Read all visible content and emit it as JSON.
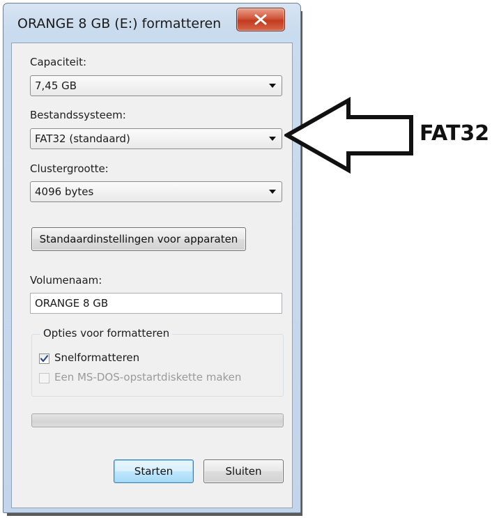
{
  "window": {
    "title": "ORANGE 8 GB (E:) formatteren"
  },
  "capacity": {
    "label": "Capaciteit:",
    "value": "7,45 GB"
  },
  "filesystem": {
    "label": "Bestandssysteem:",
    "value": "FAT32 (standaard)"
  },
  "cluster": {
    "label": "Clustergrootte:",
    "value": "4096 bytes"
  },
  "restore_defaults_label": "Standaardinstellingen voor apparaten",
  "volume": {
    "label": "Volumenaam:",
    "value": "ORANGE 8 GB"
  },
  "options": {
    "title": "Opties voor formatteren",
    "quick_format": {
      "label": "Snelformatteren",
      "checked": true,
      "enabled": true
    },
    "msdos_startup": {
      "label": "Een MS-DOS-opstartdiskette maken",
      "checked": false,
      "enabled": false
    }
  },
  "progress": {
    "fraction": 0
  },
  "buttons": {
    "start": "Starten",
    "close": "Sluiten"
  },
  "annotation": {
    "text": "FAT32"
  },
  "colors": {
    "close_button": "#c23a1f",
    "default_button_border": "#3c7fb1",
    "client_background": "#f0f0f0"
  }
}
